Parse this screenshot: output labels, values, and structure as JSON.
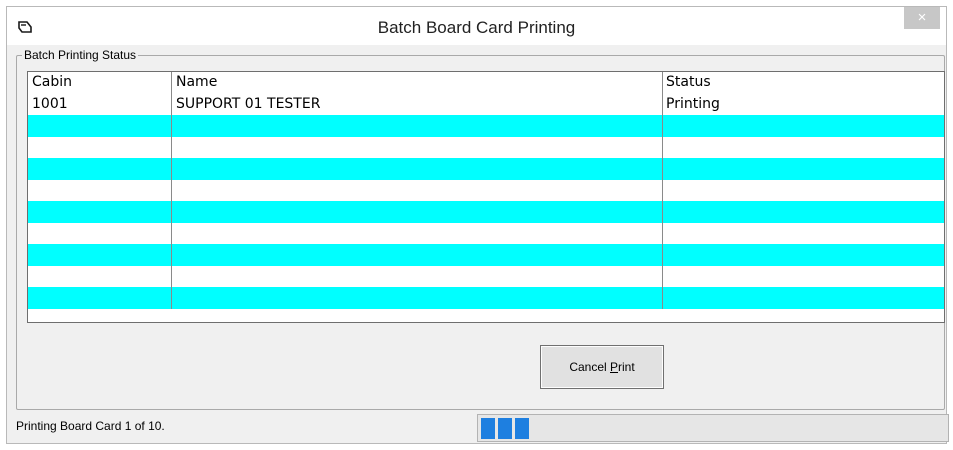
{
  "window": {
    "title": "Batch Board Card Printing",
    "close_label": "×"
  },
  "group": {
    "label": "Batch Printing Status"
  },
  "grid": {
    "columns": [
      "Cabin",
      "Name",
      "Status"
    ],
    "rows": [
      {
        "cabin": "1001",
        "name": "SUPPORT 01 TESTER",
        "status": "Printing"
      }
    ],
    "empty_row_count": 9,
    "alt_row_color": "#00ffff"
  },
  "buttons": {
    "cancel_print": "Cancel Print"
  },
  "status": {
    "text": "Printing Board Card 1 of 10.",
    "progress": 0.1
  },
  "colors": {
    "progress": "#1e7fe0"
  }
}
